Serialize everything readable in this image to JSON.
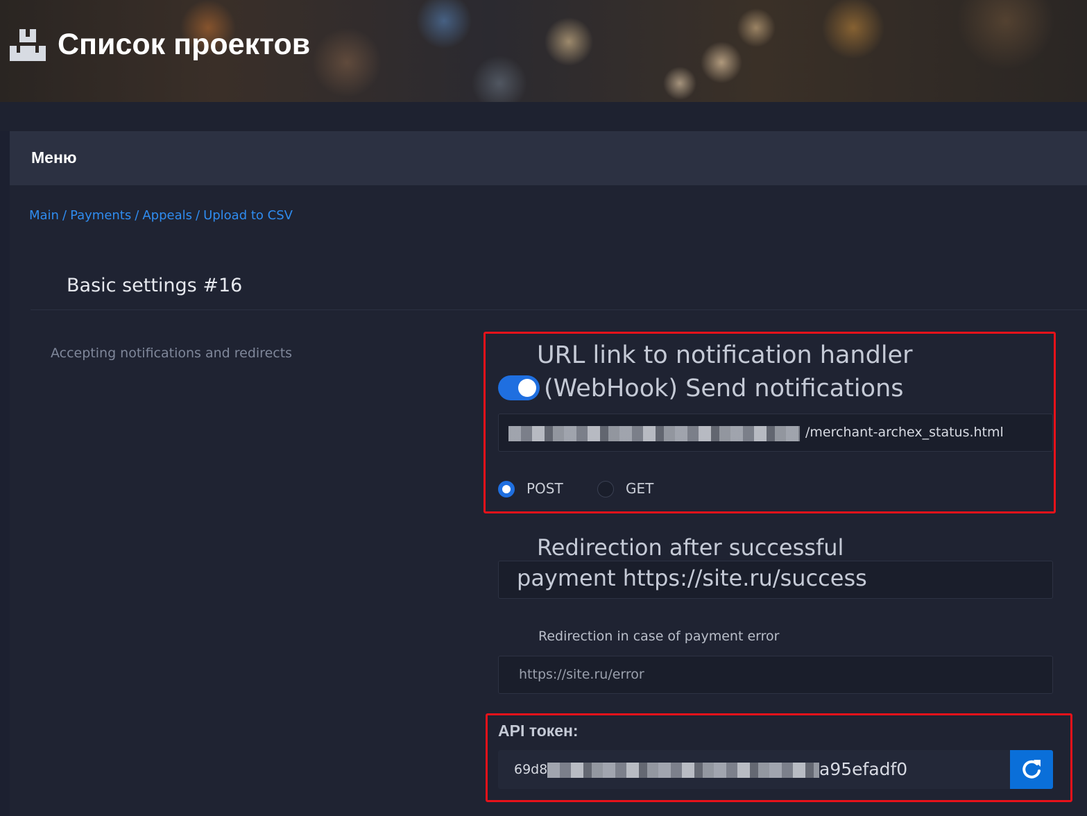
{
  "header": {
    "title": "Список проектов",
    "logo_icon": "boxes-icon"
  },
  "menu": {
    "title": "Меню"
  },
  "breadcrumb": {
    "items": [
      "Main",
      "Payments",
      "Appeals",
      "Upload to CSV"
    ],
    "separator": "/"
  },
  "section": {
    "title": "Basic settings #16",
    "subtitle": "Accepting notifications and redirects"
  },
  "webhook": {
    "title_line1": "URL link to notification handler",
    "title_line2": "(WebHook) Send notifications",
    "toggle_on": true,
    "url_value_suffix": "/merchant-archex_status.html",
    "methods": [
      {
        "label": "POST",
        "selected": true
      },
      {
        "label": "GET",
        "selected": false
      }
    ]
  },
  "success_redirect": {
    "label": "Redirection after successful",
    "value": "payment https://site.ru/success"
  },
  "error_redirect": {
    "label": "Redirection in case of payment error",
    "placeholder": "https://site.ru/error"
  },
  "api": {
    "label": "API токен:",
    "token_prefix": "69d8",
    "token_suffix": "a95efadf0",
    "refresh_icon": "refresh-icon"
  },
  "colors": {
    "accent": "#1f6fe0",
    "highlight_border": "#e8121a",
    "link": "#2f8cf0"
  }
}
